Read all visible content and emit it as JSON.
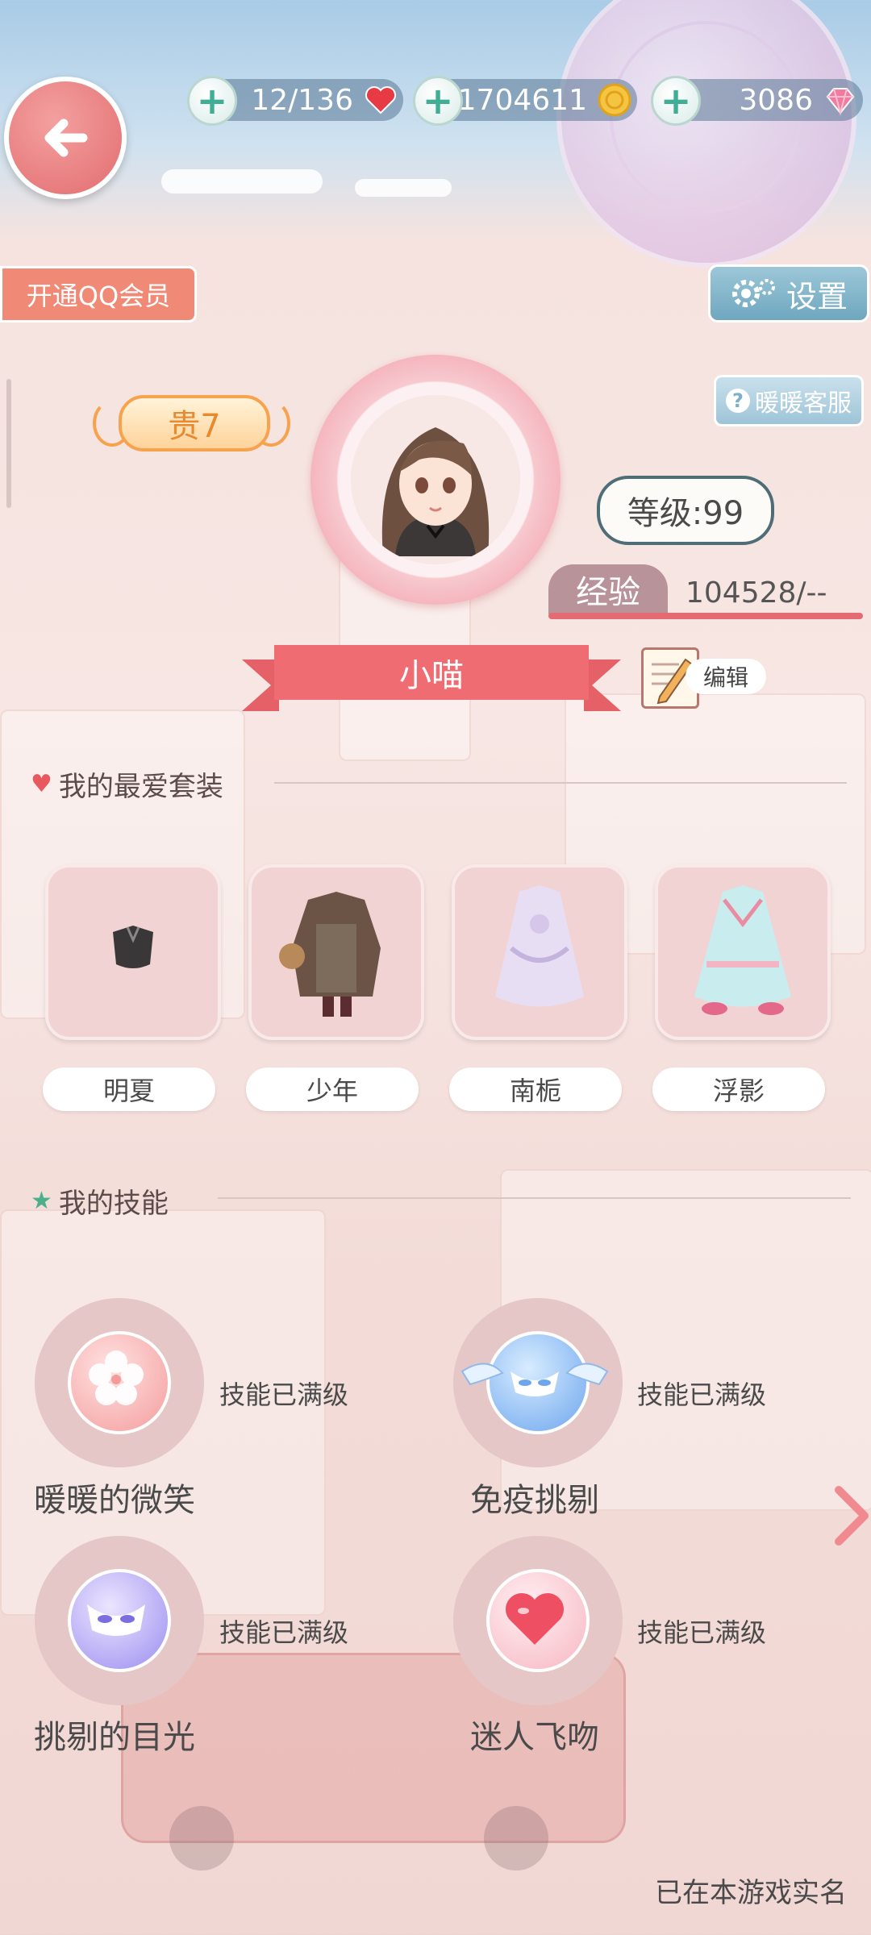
{
  "resources": {
    "stamina": {
      "value": "12/136",
      "icon": "heart-icon"
    },
    "gold": {
      "value": "1704611",
      "icon": "coin-icon"
    },
    "diamond": {
      "value": "3086",
      "icon": "diamond-icon"
    }
  },
  "buttons": {
    "qq_vip": "开通QQ会员",
    "settings": "设置",
    "customer_service": "暖暖客服",
    "edit": "编辑"
  },
  "profile": {
    "noble_rank": "贵7",
    "level": "等级:99",
    "exp_label": "经验",
    "exp_value": "104528/--",
    "name": "小喵"
  },
  "favorites": {
    "title": "我的最爱套装",
    "outfits": [
      {
        "label": "明夏"
      },
      {
        "label": "少年"
      },
      {
        "label": "南栀"
      },
      {
        "label": "浮影"
      }
    ]
  },
  "skills": {
    "title": "我的技能",
    "items": [
      {
        "name": "暖暖的微笑",
        "status": "技能已满级"
      },
      {
        "name": "免疫挑剔",
        "status": "技能已满级"
      },
      {
        "name": "挑剔的目光",
        "status": "技能已满级"
      },
      {
        "name": "迷人飞吻",
        "status": "技能已满级"
      }
    ]
  },
  "footer": {
    "realname": "已在本游戏实名"
  },
  "colors": {
    "accent": "#ee6c72",
    "vip": "#f08a76",
    "settings": "#7fb0c7",
    "noble": "#f7a24d"
  }
}
